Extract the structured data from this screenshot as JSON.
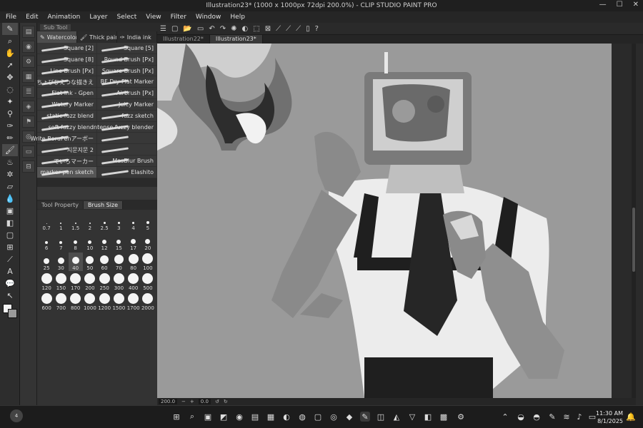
{
  "window": {
    "title": "Illustration23* (1000 x 1000px 72dpi 200.0%) - CLIP STUDIO PAINT PRO",
    "controls": [
      "—",
      "☐",
      "✕"
    ]
  },
  "menu": [
    "File",
    "Edit",
    "Animation",
    "Layer",
    "Select",
    "View",
    "Filter",
    "Window",
    "Help"
  ],
  "subtool": {
    "header": "Sub Tool",
    "tabs": [
      {
        "label": "Watercolor",
        "active": true
      },
      {
        "label": "Thick paint",
        "active": false
      },
      {
        "label": "India ink",
        "active": false
      }
    ],
    "brushes": [
      "Square [2]",
      "Square [5]",
      "Square [8]",
      "Round Brush [Px]",
      "Line Brush [Px]",
      "Square Brush [Px]",
      "ちょびひえつな描きえ",
      "BF Dry Flat Marker",
      "Flat Ink - Gpen",
      "Airbrush [Px]",
      "Watery Marker",
      "Juicy Marker",
      "static fuzz blend",
      "fuzz sketch",
      "soft fuzzy blend",
      "intense fuzzy blender",
      "Write BoruPenアーボー",
      "",
      "지문지문 2",
      "",
      "ていろマーカー",
      "MasBlur Brush",
      "marker-pen sketch",
      "Elashito"
    ],
    "active_brush_index": 22
  },
  "lower_panel": {
    "tabs": [
      "Tool Property",
      "Brush Size"
    ],
    "active_tab": 1,
    "sizes": [
      "0.7",
      "1",
      "1.5",
      "2",
      "2.5",
      "3",
      "4",
      "5",
      "6",
      "7",
      "8",
      "10",
      "12",
      "15",
      "17",
      "20",
      "25",
      "30",
      "40",
      "50",
      "60",
      "70",
      "80",
      "100",
      "120",
      "150",
      "170",
      "200",
      "250",
      "300",
      "400",
      "500",
      "600",
      "700",
      "800",
      "1000",
      "1200",
      "1500",
      "1700",
      "2000"
    ],
    "selected_size": "40"
  },
  "doc_tabs": [
    {
      "label": "Illustration22*",
      "active": false
    },
    {
      "label": "Illustration23*",
      "active": true
    }
  ],
  "status": {
    "zoom": "200.0",
    "rotation": "0.0"
  },
  "taskbar": {
    "time": "11:30 AM",
    "date": "8/1/2025",
    "badge": "4"
  },
  "colors": {
    "canvas_bg": "#9a9a9a",
    "ui_bg": "#2b2b2b"
  }
}
